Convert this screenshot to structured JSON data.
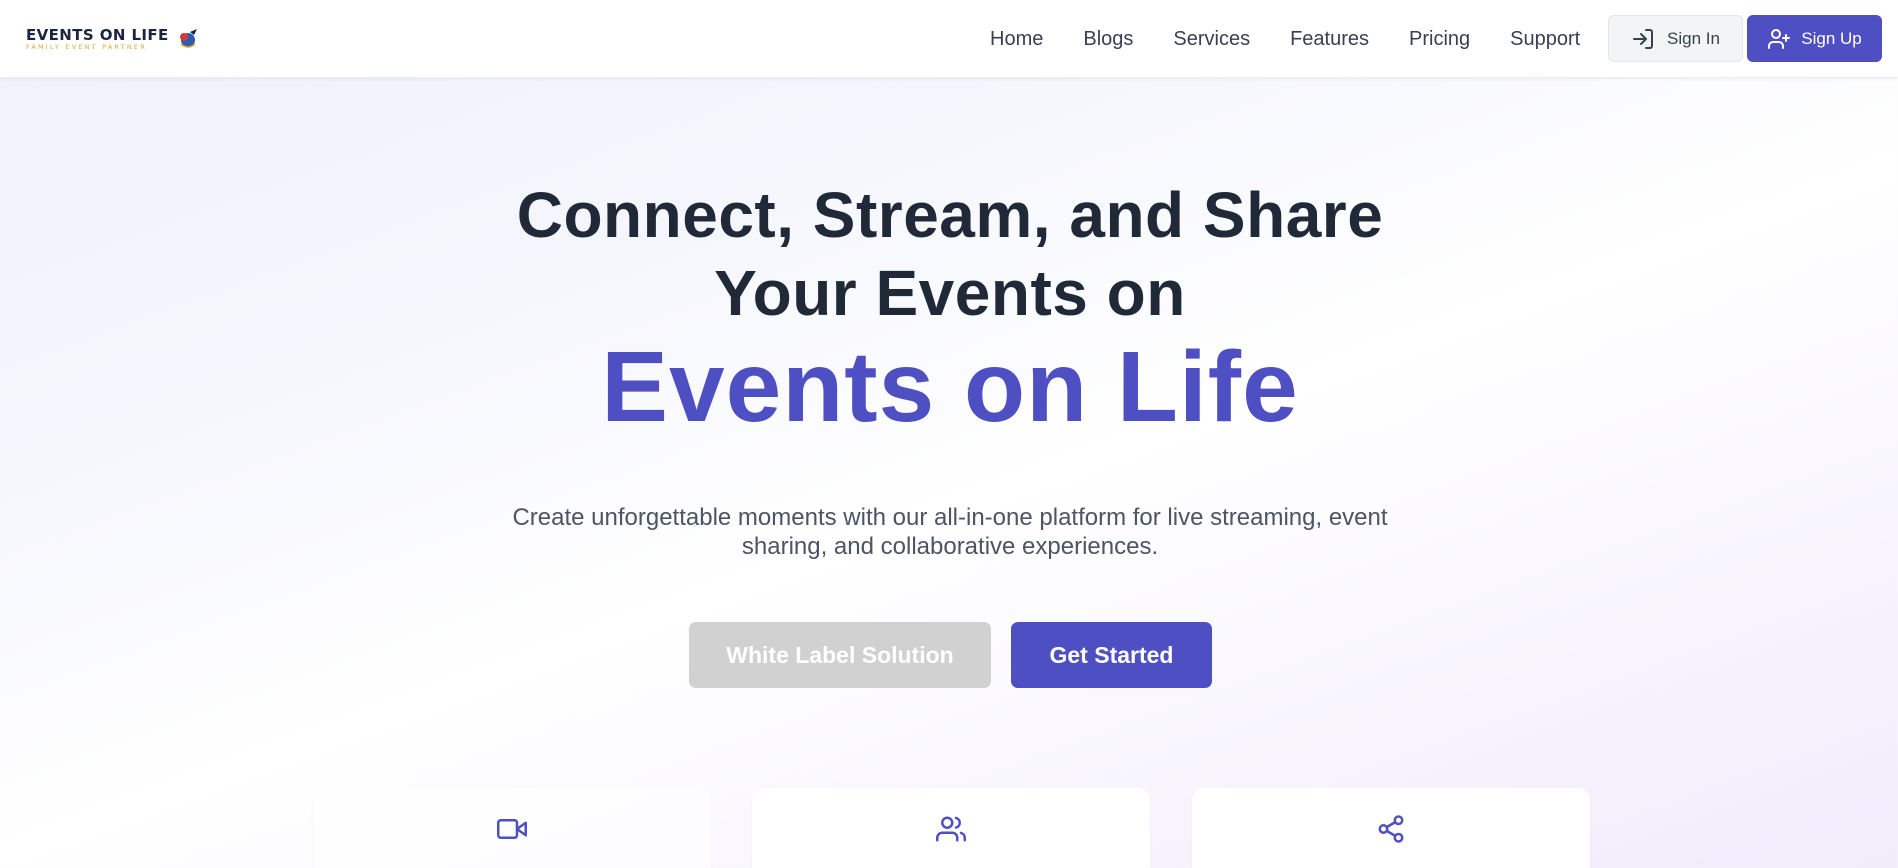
{
  "brand": {
    "name": "EVENTS ON LIFE",
    "tagline": "FAMILY EVENT PARTNER",
    "accent_color": "#4f4fc4"
  },
  "nav": {
    "items": [
      "Home",
      "Blogs",
      "Services",
      "Features",
      "Pricing",
      "Support"
    ]
  },
  "auth": {
    "sign_in": "Sign In",
    "sign_up": "Sign Up"
  },
  "hero": {
    "title_line1": "Connect, Stream, and Share",
    "title_line2": "Your Events on",
    "brand_line": "Events on Life",
    "subtitle_line1": "Create unforgettable moments with our all-in-one platform for live streaming, event",
    "subtitle_line2": "sharing, and collaborative experiences.",
    "cta_secondary": "White Label Solution",
    "cta_primary": "Get Started"
  },
  "features": {
    "cards": [
      {
        "icon": "video-icon"
      },
      {
        "icon": "users-icon"
      },
      {
        "icon": "share-icon"
      }
    ]
  }
}
